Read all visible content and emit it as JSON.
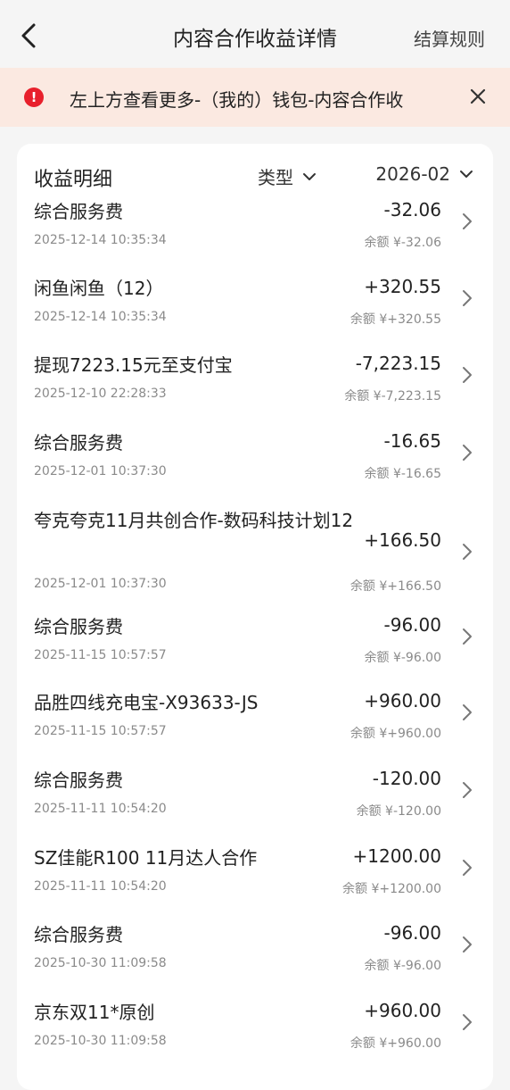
{
  "header": {
    "title": "内容合作收益详情",
    "rules_label": "结算规则"
  },
  "notice": {
    "text": "左上方查看更多-（我的）钱包-内容合作收",
    "accent": "#e8202c",
    "background": "#fbe9e1"
  },
  "card": {
    "title": "收益明细",
    "type_filter": "类型",
    "month_filter": "2026-02"
  },
  "items": [
    {
      "title": "综合服务费",
      "time": "2025-12-14 10:35:34",
      "amount": "-32.06",
      "balance": "余额 ¥-32.06"
    },
    {
      "title": "闲鱼闲鱼（12）",
      "time": "2025-12-14 10:35:34",
      "amount": "+320.55",
      "balance": "余额 ¥+320.55"
    },
    {
      "title": "提现7223.15元至支付宝",
      "time": "2025-12-10 22:28:33",
      "amount": "-7,223.15",
      "balance": "余额 ¥-7,223.15"
    },
    {
      "title": "综合服务费",
      "time": "2025-12-01 10:37:30",
      "amount": "-16.65",
      "balance": "余额 ¥-16.65"
    },
    {
      "title": "夸克夸克11月共创合作-数码科技计划12",
      "time": "2025-12-01 10:37:30",
      "amount": "+166.50",
      "balance": "余额 ¥+166.50"
    },
    {
      "title": "综合服务费",
      "time": "2025-11-15 10:57:57",
      "amount": "-96.00",
      "balance": "余额 ¥-96.00"
    },
    {
      "title": "品胜四线充电宝-X93633-JS",
      "time": "2025-11-15 10:57:57",
      "amount": "+960.00",
      "balance": "余额 ¥+960.00"
    },
    {
      "title": "综合服务费",
      "time": "2025-11-11 10:54:20",
      "amount": "-120.00",
      "balance": "余额 ¥-120.00"
    },
    {
      "title": "SZ佳能R100 11月达人合作",
      "time": "2025-11-11 10:54:20",
      "amount": "+1200.00",
      "balance": "余额 ¥+1200.00"
    },
    {
      "title": "综合服务费",
      "time": "2025-10-30 11:09:58",
      "amount": "-96.00",
      "balance": "余额 ¥-96.00"
    },
    {
      "title": "京东双11*原创",
      "time": "2025-10-30 11:09:58",
      "amount": "+960.00",
      "balance": "余额 ¥+960.00"
    }
  ]
}
